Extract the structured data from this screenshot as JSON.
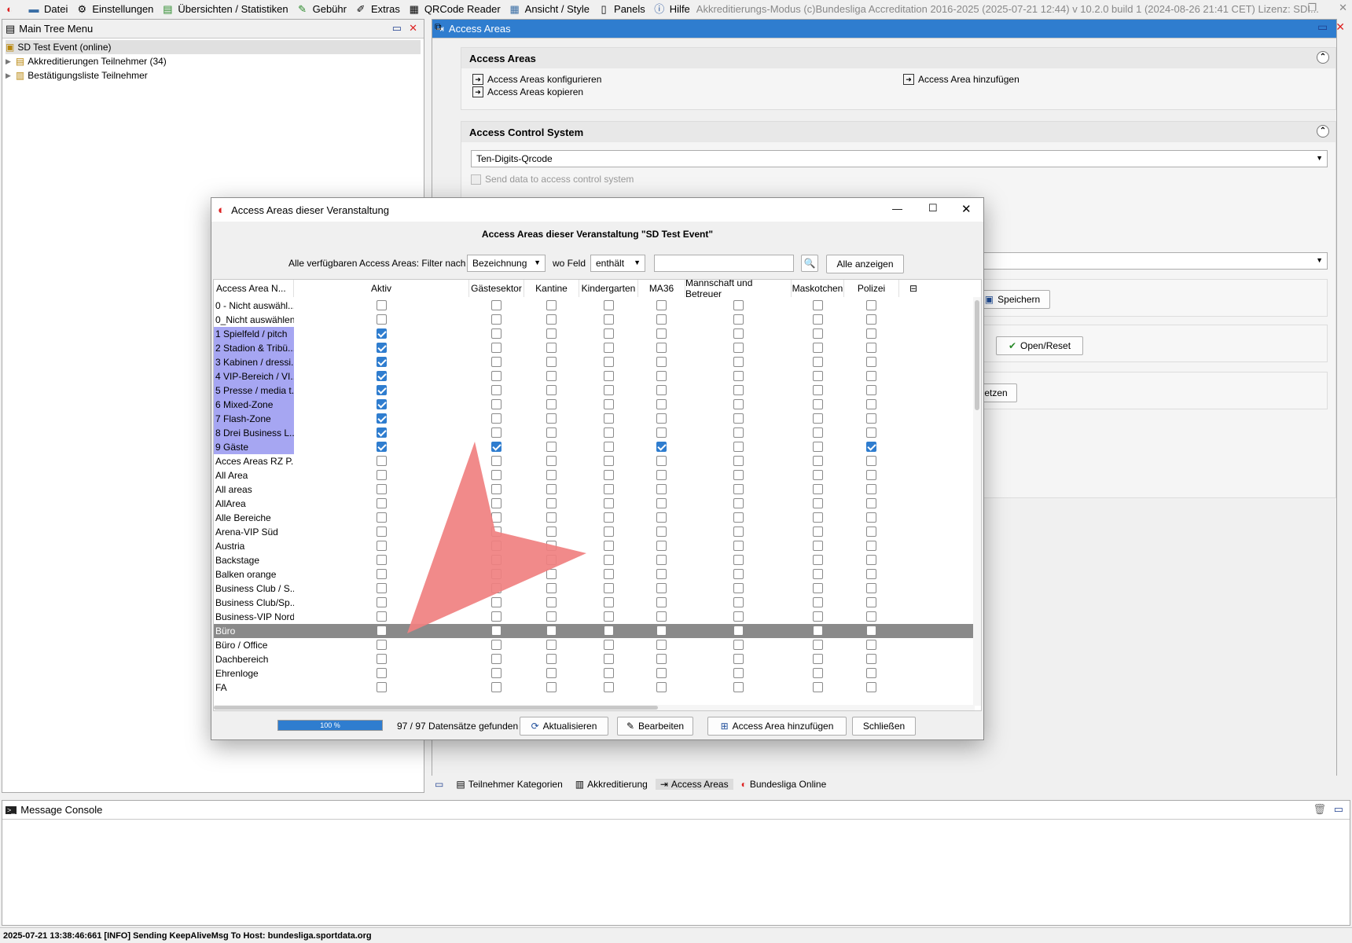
{
  "menu": {
    "items": [
      {
        "label": "Datei",
        "icon": "folder-icon"
      },
      {
        "label": "Einstellungen",
        "icon": "gear-icon"
      },
      {
        "label": "Übersichten / Statistiken",
        "icon": "stats-icon"
      },
      {
        "label": "Gebühr",
        "icon": "money-icon"
      },
      {
        "label": "Extras",
        "icon": "wrench-icon"
      },
      {
        "label": "QRCode Reader",
        "icon": "qrcode-icon"
      },
      {
        "label": "Ansicht / Style",
        "icon": "grid-icon"
      },
      {
        "label": "Panels",
        "icon": "panel-icon"
      },
      {
        "label": "Hilfe",
        "icon": "help-icon"
      }
    ],
    "app_title": "Akkreditierungs-Modus (c)Bundesliga Accreditation 2016-2025 (2025-07-21 12:44) v 10.2.0 build 1 (2024-08-26 21:41 CET) Lizenz: SDI..."
  },
  "tree": {
    "title": "Main Tree Menu",
    "root": "SD Test Event (online)",
    "children": [
      "Akkreditierungen Teilnehmer (34)",
      "Bestätigungsliste Teilnehmer"
    ]
  },
  "main": {
    "title": "Access Areas",
    "section1": {
      "title": "Access Areas",
      "links_left": [
        "Access Areas konfigurieren",
        "Access Areas kopieren"
      ],
      "link_right": "Access Area hinzufügen"
    },
    "section2": {
      "title": "Access Control System",
      "select": "Ten-Digits-Qrcode",
      "checkbox_label": "Send data to access control system"
    },
    "buttons": {
      "save": "Speichern",
      "open_reset": "Open/Reset",
      "setzen": "etzen"
    },
    "tabs": [
      "Teilnehmer Kategorien",
      "Akkreditierung",
      "Access Areas",
      "Bundesliga Online"
    ]
  },
  "dialog": {
    "title": "Access Areas dieser Veranstaltung",
    "heading": "Access Areas dieser Veranstaltung \"SD Test Event\"",
    "filter": {
      "label": "Alle verfügbaren Access Areas: Filter nach",
      "field": "Bezeichnung",
      "wo_feld": "wo Feld",
      "op": "enthält",
      "value": "",
      "show_all": "Alle anzeigen"
    },
    "columns": [
      "Access Area N...",
      "Aktiv",
      "Gästesektor",
      "Kantine",
      "Kindergarten",
      "MA36",
      "Mannschaft und Betreuer",
      "Maskotchen",
      "Polizei"
    ],
    "rows": [
      {
        "name": "0 - Nicht auswähl...",
        "hi": false,
        "v": [
          0,
          0,
          0,
          0,
          0,
          0,
          0,
          0
        ]
      },
      {
        "name": "0_Nicht auswählen",
        "hi": false,
        "v": [
          0,
          0,
          0,
          0,
          0,
          0,
          0,
          0
        ]
      },
      {
        "name": "1 Spielfeld / pitch",
        "hi": true,
        "v": [
          1,
          0,
          0,
          0,
          0,
          0,
          0,
          0
        ]
      },
      {
        "name": "2 Stadion & Tribü...",
        "hi": true,
        "v": [
          1,
          0,
          0,
          0,
          0,
          0,
          0,
          0
        ]
      },
      {
        "name": "3 Kabinen / dressi...",
        "hi": true,
        "v": [
          1,
          0,
          0,
          0,
          0,
          0,
          0,
          0
        ]
      },
      {
        "name": "4 VIP-Bereich / VI...",
        "hi": true,
        "v": [
          1,
          0,
          0,
          0,
          0,
          0,
          0,
          0
        ]
      },
      {
        "name": "5 Presse / media t...",
        "hi": true,
        "v": [
          1,
          0,
          0,
          0,
          0,
          0,
          0,
          0
        ]
      },
      {
        "name": "6 Mixed-Zone",
        "hi": true,
        "v": [
          1,
          0,
          0,
          0,
          0,
          0,
          0,
          0
        ]
      },
      {
        "name": "7 Flash-Zone",
        "hi": true,
        "v": [
          1,
          0,
          0,
          0,
          0,
          0,
          0,
          0
        ]
      },
      {
        "name": "8 Drei Business L...",
        "hi": true,
        "v": [
          1,
          0,
          0,
          0,
          0,
          0,
          0,
          0
        ]
      },
      {
        "name": "9 Gäste",
        "hi": true,
        "v": [
          1,
          1,
          0,
          0,
          1,
          0,
          0,
          1
        ]
      },
      {
        "name": "Acces Areas RZ P...",
        "hi": false,
        "v": [
          0,
          0,
          0,
          0,
          0,
          0,
          0,
          0
        ]
      },
      {
        "name": "All Area",
        "hi": false,
        "v": [
          0,
          0,
          0,
          0,
          0,
          0,
          0,
          0
        ]
      },
      {
        "name": "All areas",
        "hi": false,
        "v": [
          0,
          0,
          0,
          0,
          0,
          0,
          0,
          0
        ]
      },
      {
        "name": "AllArea",
        "hi": false,
        "v": [
          0,
          0,
          0,
          0,
          0,
          0,
          0,
          0
        ]
      },
      {
        "name": "Alle Bereiche",
        "hi": false,
        "v": [
          0,
          0,
          0,
          0,
          0,
          0,
          0,
          0
        ]
      },
      {
        "name": "Arena-VIP Süd",
        "hi": false,
        "v": [
          0,
          0,
          0,
          0,
          0,
          0,
          0,
          0
        ]
      },
      {
        "name": "Austria",
        "hi": false,
        "v": [
          0,
          0,
          0,
          0,
          0,
          0,
          0,
          0
        ]
      },
      {
        "name": "Backstage",
        "hi": false,
        "v": [
          0,
          0,
          0,
          0,
          0,
          0,
          0,
          0
        ]
      },
      {
        "name": "Balken orange",
        "hi": false,
        "v": [
          0,
          0,
          0,
          0,
          0,
          0,
          0,
          0
        ]
      },
      {
        "name": "Business Club / S...",
        "hi": false,
        "v": [
          0,
          0,
          0,
          0,
          0,
          0,
          0,
          0
        ]
      },
      {
        "name": "Business Club/Sp...",
        "hi": false,
        "v": [
          0,
          0,
          0,
          0,
          0,
          0,
          0,
          0
        ]
      },
      {
        "name": "Business-VIP Nord",
        "hi": false,
        "v": [
          0,
          0,
          0,
          0,
          0,
          0,
          0,
          0
        ]
      },
      {
        "name": "Büro",
        "hi": false,
        "sel": true,
        "v": [
          0,
          0,
          0,
          0,
          0,
          0,
          0,
          0
        ]
      },
      {
        "name": "Büro / Office",
        "hi": false,
        "v": [
          0,
          0,
          0,
          0,
          0,
          0,
          0,
          0
        ]
      },
      {
        "name": "Dachbereich",
        "hi": false,
        "v": [
          0,
          0,
          0,
          0,
          0,
          0,
          0,
          0
        ]
      },
      {
        "name": "Ehrenloge",
        "hi": false,
        "v": [
          0,
          0,
          0,
          0,
          0,
          0,
          0,
          0
        ]
      },
      {
        "name": "FA",
        "hi": false,
        "v": [
          0,
          0,
          0,
          0,
          0,
          0,
          0,
          0
        ]
      }
    ],
    "footer": {
      "progress_text": "100 %",
      "progress": 1.0,
      "count_text": "97 / 97 Datensätze gefunden",
      "refresh": "Aktualisieren",
      "edit": "Bearbeiten",
      "add": "Access Area hinzufügen",
      "close": "Schließen"
    }
  },
  "console": {
    "title": "Message Console"
  },
  "status": "2025-07-21 13:38:46:661 [INFO] Sending KeepAliveMsg To Host: bundesliga.sportdata.org",
  "colors": {
    "accent": "#2f7dcf",
    "highlight": "#a6a6f2",
    "selected_row": "#8a8a8a",
    "cursor": "#f08080"
  }
}
